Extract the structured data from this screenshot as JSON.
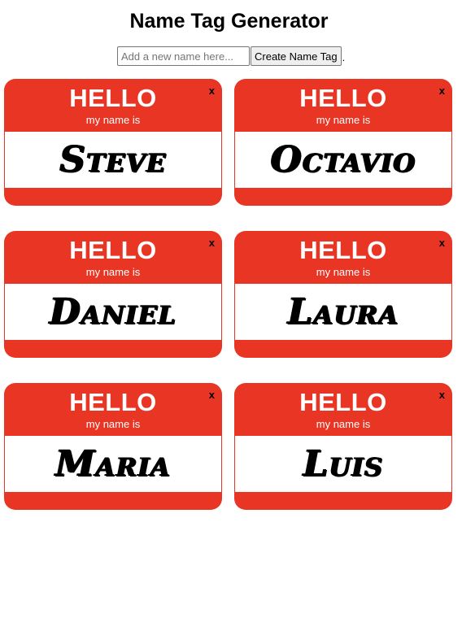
{
  "header": {
    "title": "Name Tag Generator"
  },
  "form": {
    "input_value": "",
    "input_placeholder": "Add a new name here...",
    "button_label": "Create Name Tag",
    "trailing_text": "."
  },
  "tag_template": {
    "hello": "HELLO",
    "subtitle": "my name is",
    "close": "x"
  },
  "tags": [
    {
      "name": "Steve"
    },
    {
      "name": "Octavio"
    },
    {
      "name": "Daniel"
    },
    {
      "name": "Laura"
    },
    {
      "name": "Maria"
    },
    {
      "name": "Luis"
    }
  ],
  "colors": {
    "tag_red": "#e83524",
    "tag_body": "#ffffff"
  }
}
